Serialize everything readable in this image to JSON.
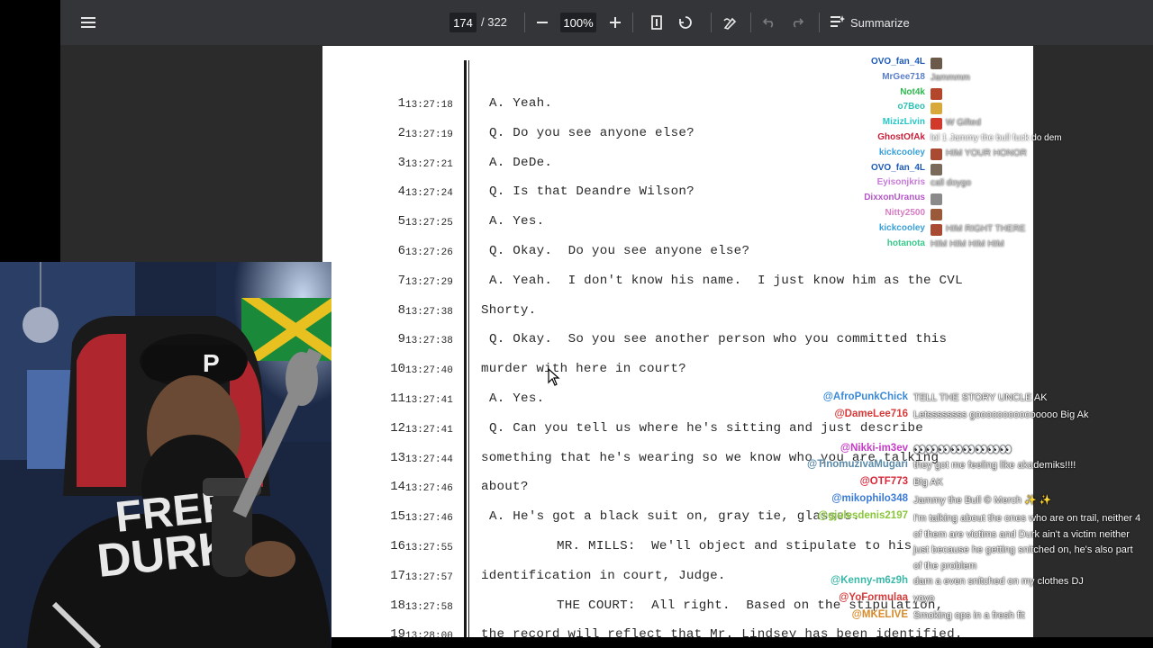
{
  "toolbar": {
    "current_page": "174",
    "total_pages": "/ 322",
    "zoom": "100%",
    "summarize_label": "Summarize",
    "icons": [
      "menu-icon",
      "zoom-out-icon",
      "zoom-in-icon",
      "fit-page-icon",
      "rotate-icon",
      "draw-icon",
      "undo-icon",
      "redo-icon",
      "summarize-icon"
    ]
  },
  "transcript": [
    {
      "n": "1",
      "time": "13:27:18",
      "text": "A. Yeah.",
      "indent": 1
    },
    {
      "n": "2",
      "time": "13:27:19",
      "text": "Q. Do you see anyone else?",
      "indent": 1
    },
    {
      "n": "3",
      "time": "13:27:21",
      "text": "A. DeDe.",
      "indent": 1
    },
    {
      "n": "4",
      "time": "13:27:24",
      "text": "Q. Is that Deandre Wilson?",
      "indent": 1
    },
    {
      "n": "5",
      "time": "13:27:25",
      "text": "A. Yes.",
      "indent": 1
    },
    {
      "n": "6",
      "time": "13:27:26",
      "text": "Q. Okay.  Do you see anyone else?",
      "indent": 1
    },
    {
      "n": "7",
      "time": "13:27:29",
      "text": "A. Yeah.  I don't know his name.  I just know him as the CVL",
      "indent": 1
    },
    {
      "n": "8",
      "time": "13:27:38",
      "text": "Shorty.",
      "indent": 0
    },
    {
      "n": "9",
      "time": "13:27:38",
      "text": "Q. Okay.  So you see another person who you committed this",
      "indent": 1
    },
    {
      "n": "10",
      "time": "13:27:40",
      "text": "murder with here in court?",
      "indent": 0
    },
    {
      "n": "11",
      "time": "13:27:41",
      "text": "A. Yes.",
      "indent": 1
    },
    {
      "n": "12",
      "time": "13:27:41",
      "text": "Q. Can you tell us where he's sitting and just describe",
      "indent": 1
    },
    {
      "n": "13",
      "time": "13:27:44",
      "text": "something that he's wearing so we know who you are talking",
      "indent": 0
    },
    {
      "n": "14",
      "time": "13:27:46",
      "text": "about?",
      "indent": 0
    },
    {
      "n": "15",
      "time": "13:27:46",
      "text": "A. He's got a black suit on, gray tie, glasses.",
      "indent": 1
    },
    {
      "n": "16",
      "time": "13:27:55",
      "text": "MR. MILLS:  We'll object and stipulate to his",
      "indent": 2
    },
    {
      "n": "17",
      "time": "13:27:57",
      "text": "identification in court, Judge.",
      "indent": 0
    },
    {
      "n": "18",
      "time": "13:27:58",
      "text": "THE COURT:  All right.  Based on the stipulation,",
      "indent": 2
    },
    {
      "n": "19",
      "time": "13:28:00",
      "text": "the record will reflect that Mr. Lindsey has been identified.",
      "indent": 0
    }
  ],
  "chat_top": [
    {
      "name": "OVO_fan_4L",
      "color": "#1e5bb8",
      "msg": "",
      "emote": "#6b5a4a"
    },
    {
      "name": "MrGee718",
      "color": "#5b7fc6",
      "msg": "Jammmm",
      "emote": ""
    },
    {
      "name": "Not4k",
      "color": "#2db84f",
      "msg": "",
      "emote": "#b3462b"
    },
    {
      "name": "o7Beo",
      "color": "#2fbfb3",
      "msg": "",
      "emote": "#d9a83a"
    },
    {
      "name": "MizizLivin",
      "color": "#28c7c7",
      "msg": "W Gifted",
      "emote": "#d13a2a"
    },
    {
      "name": "GhostOfAk",
      "color": "#c8203a",
      "msg": "lol 1 Jammy the bull fuck do dem",
      "emote": ""
    },
    {
      "name": "kickcooley",
      "color": "#3aa0d8",
      "msg": "HIM YOUR HONOR",
      "emote": "#a94a32"
    },
    {
      "name": "OVO_fan_4L",
      "color": "#1e5bb8",
      "msg": "",
      "emote": "#7a6a5a"
    },
    {
      "name": "Eyisonjkris",
      "color": "#c77bd8",
      "msg": "call doygo",
      "emote": ""
    },
    {
      "name": "DixxonUranus",
      "color": "#b557c9",
      "msg": "",
      "emote": "#8a8a8a"
    },
    {
      "name": "Nitty2500",
      "color": "#d87cc4",
      "msg": "",
      "emote": "#9a5a3a"
    },
    {
      "name": "kickcooley",
      "color": "#3aa0d8",
      "msg": "HIM RIGHT THERE",
      "emote": "#a94a32"
    },
    {
      "name": "hotanota",
      "color": "#3ac88a",
      "msg": "HIM HIM HIM HIM",
      "emote": ""
    }
  ],
  "chat_bottom": [
    {
      "name": "@AfroPunkChick",
      "color": "#3a8ad8",
      "msg": "TELL THE STORY UNCLE AK"
    },
    {
      "name": "@DameLee716",
      "color": "#d83a3a",
      "msg": "Letssssssss gooooooooooooooo Big Ak"
    },
    {
      "name": "@Nikki-im3ev",
      "color": "#c83ac8",
      "msg": "👀👀👀👀👀👀👀👀"
    },
    {
      "name": "@TinomuzivaMugari",
      "color": "#5a8aa8",
      "msg": "they got me feeling like akademiks!!!!"
    },
    {
      "name": "@OTF773",
      "color": "#d8283a",
      "msg": "Big AK"
    },
    {
      "name": "@mikophilo348",
      "color": "#3a7ad8",
      "msg": "Jammy the Bull © Merch ✨ ✨"
    },
    {
      "name": "@gjulesdenis2197",
      "color": "#8ac83a",
      "msg": "I'm talking about the ones who are on trail, neither 4 of them are victims and Durk ain't a victim neither just because he getting snitched on, he's also part of the problem"
    },
    {
      "name": "@Kenny-m6z9h",
      "color": "#3ab8a8",
      "msg": "dam a even snitched on my clothes DJ"
    },
    {
      "name": "@YoFormulaa",
      "color": "#d83a3a",
      "msg": "yoyo"
    },
    {
      "name": "@MKELIVE",
      "color": "#d88a28",
      "msg": "Smoking ops in a fresh fit"
    }
  ],
  "webcam": {
    "hat_letter": "P",
    "shirt_text_1": "FREE",
    "shirt_text_2": "DURK"
  }
}
